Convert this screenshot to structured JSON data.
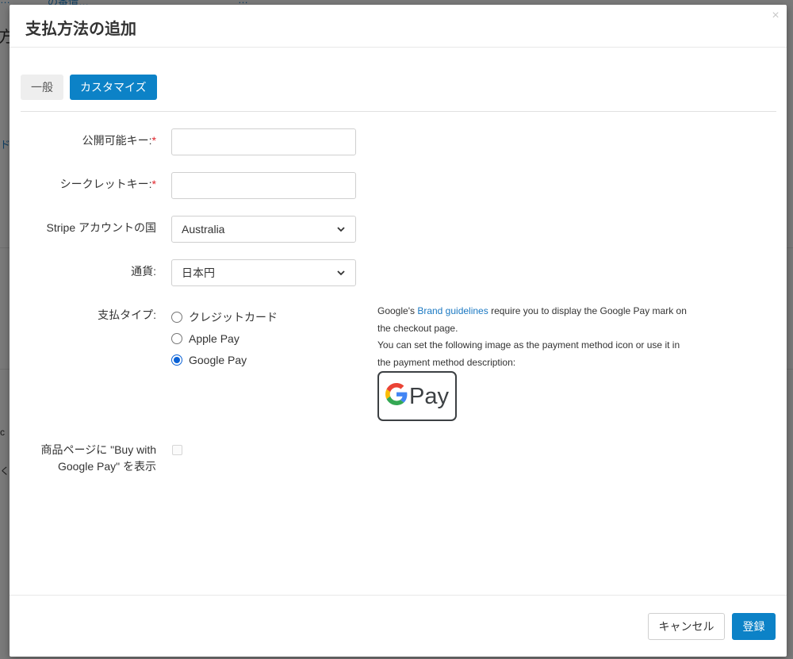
{
  "background": {
    "nav_items": [
      "…",
      "の番情…",
      "…"
    ],
    "left_fragments": [
      "方",
      "ド",
      "c",
      "く"
    ]
  },
  "modal": {
    "title": "支払方法の追加",
    "close_label": "×"
  },
  "tabs": [
    {
      "label": "一般",
      "active": false
    },
    {
      "label": "カスタマイズ",
      "active": true
    }
  ],
  "form": {
    "publishable_key": {
      "label": "公開可能キー:",
      "required_mark": "*",
      "value": ""
    },
    "secret_key": {
      "label": "シークレットキー:",
      "required_mark": "*",
      "value": ""
    },
    "stripe_country": {
      "label": "Stripe アカウントの国",
      "selected": "Australia"
    },
    "currency": {
      "label": "通貨:",
      "selected": "日本円"
    },
    "payment_type": {
      "label": "支払タイプ:",
      "options": [
        {
          "label": "クレジットカード",
          "checked": false
        },
        {
          "label": "Apple Pay",
          "checked": false
        },
        {
          "label": "Google Pay",
          "checked": true
        }
      ]
    },
    "buy_button": {
      "label_line1": "商品ページに \"Buy with",
      "label_line2": "Google Pay\" を表示",
      "checked": false
    }
  },
  "google_pay_note": {
    "text_before_link": "Google's ",
    "link_text": "Brand guidelines",
    "text_after_link": " require you to display the Google Pay mark on the checkout page.",
    "line2": "You can set the following image as the payment method icon or use it in the payment method description:",
    "mark_text": "Pay"
  },
  "footer": {
    "cancel_label": "キャンセル",
    "submit_label": "登録"
  },
  "colors": {
    "primary": "#0c82c7",
    "link": "#1a78c2",
    "required": "#e0232a"
  }
}
